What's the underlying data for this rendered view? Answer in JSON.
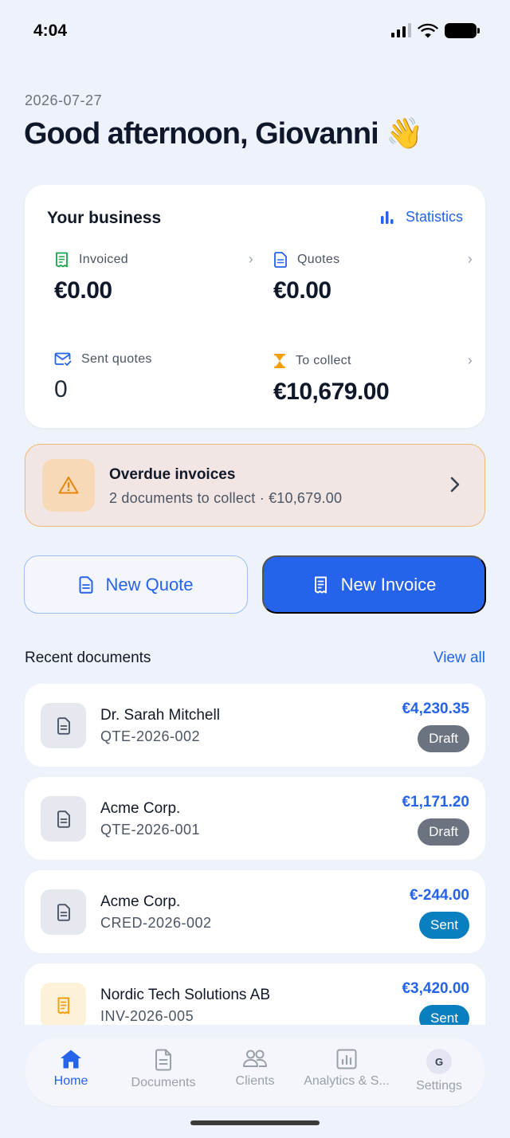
{
  "status_bar": {
    "time": "4:04"
  },
  "header": {
    "date": "2026-07-27",
    "greeting": "Good afternoon, Giovanni 👋"
  },
  "business": {
    "title": "Your business",
    "statistics_label": "Statistics",
    "metrics": [
      {
        "label": "Invoiced",
        "value": "€0.00"
      },
      {
        "label": "Quotes",
        "value": "€0.00"
      },
      {
        "label": "Sent quotes",
        "value": "0"
      },
      {
        "label": "To collect",
        "value": "€10,679.00"
      }
    ]
  },
  "overdue": {
    "title": "Overdue invoices",
    "subtitle": "2 documents to collect · €10,679.00"
  },
  "actions": {
    "new_quote": "New Quote",
    "new_invoice": "New Invoice"
  },
  "recent": {
    "title": "Recent documents",
    "view_all": "View all",
    "documents": [
      {
        "client": "Dr. Sarah Mitchell",
        "number": "QTE-2026-002",
        "amount": "€4,230.35",
        "status": "Draft",
        "icon": "document-icon"
      },
      {
        "client": "Acme Corp.",
        "number": "QTE-2026-001",
        "amount": "€1,171.20",
        "status": "Draft",
        "icon": "document-icon"
      },
      {
        "client": "Acme Corp.",
        "number": "CRED-2026-002",
        "amount": "€-244.00",
        "status": "Sent",
        "icon": "document-icon"
      },
      {
        "client": "Nordic Tech Solutions AB",
        "number": "INV-2026-005",
        "amount": "€3,420.00",
        "status": "Sent",
        "icon": "invoice-icon"
      }
    ]
  },
  "nav": {
    "items": [
      {
        "label": "Home",
        "icon": "home-icon"
      },
      {
        "label": "Documents",
        "icon": "document-icon"
      },
      {
        "label": "Clients",
        "icon": "users-icon"
      },
      {
        "label": "Analytics & S...",
        "icon": "analytics-icon"
      },
      {
        "label": "Settings",
        "icon": "avatar"
      }
    ],
    "avatar_initial": "G"
  },
  "colors": {
    "accent": "#2563eb",
    "warning": "#e8860c",
    "draft": "#6b7280",
    "sent": "#0a7fc0",
    "background": "#eef2fa"
  }
}
